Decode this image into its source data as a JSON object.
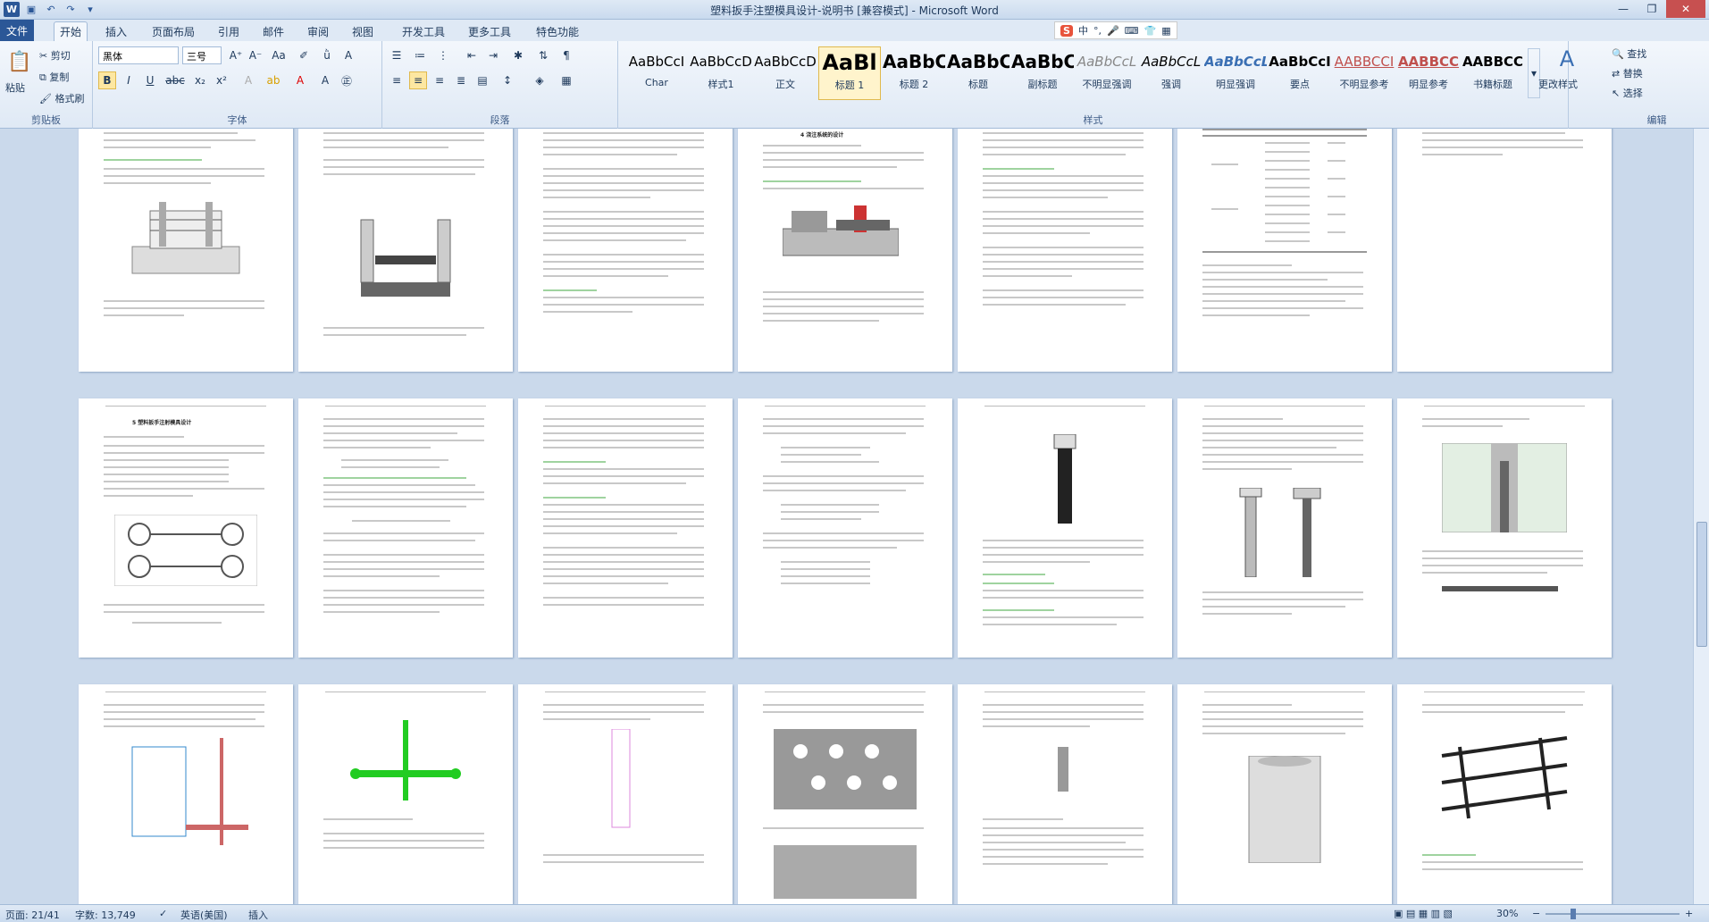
{
  "window": {
    "title": "塑料扳手注塑模具设计-说明书 [兼容模式] - Microsoft Word"
  },
  "tabs": {
    "file": "文件",
    "items": [
      "开始",
      "插入",
      "页面布局",
      "引用",
      "邮件",
      "审阅",
      "视图",
      "开发工具",
      "更多工具",
      "特色功能"
    ]
  },
  "clipboard": {
    "paste": "粘贴",
    "cut": "剪切",
    "copy": "复制",
    "format_painter": "格式刷",
    "label": "剪贴板"
  },
  "font": {
    "name": "黑体",
    "size": "三号",
    "label": "字体"
  },
  "paragraph": {
    "label": "段落"
  },
  "styles": {
    "label": "样式",
    "items": [
      {
        "preview": "AaBbCcI",
        "name": "Char"
      },
      {
        "preview": "AaBbCcD",
        "name": "样式1"
      },
      {
        "preview": "AaBbCcD",
        "name": "正文"
      },
      {
        "preview": "AaBl",
        "name": "标题 1"
      },
      {
        "preview": "AaBbC",
        "name": "标题 2"
      },
      {
        "preview": "AaBbC",
        "name": "标题"
      },
      {
        "preview": "AaBbC",
        "name": "副标题"
      },
      {
        "preview": "AaBbCcL",
        "name": "不明显强调"
      },
      {
        "preview": "AaBbCcL",
        "name": "强调"
      },
      {
        "preview": "AaBbCcL",
        "name": "明显强调"
      },
      {
        "preview": "AaBbCcI",
        "name": "要点"
      },
      {
        "preview": "AABBCCI",
        "name": "不明显参考"
      },
      {
        "preview": "AABBCC",
        "name": "明显参考"
      },
      {
        "preview": "AABBCC",
        "name": "书籍标题"
      }
    ],
    "change": "更改样式"
  },
  "editing": {
    "label": "编辑",
    "find": "查找",
    "replace": "替换",
    "select": "选择"
  },
  "ime": {
    "mode": "中"
  },
  "document": {
    "heading_section4": "4 浇注系统的设计",
    "heading_section5": "5 塑料扳手注射模具设计"
  },
  "status": {
    "page": "页面: 21/41",
    "words": "字数: 13,749",
    "lang": "英语(美国)",
    "mode": "插入",
    "zoom": "30%"
  }
}
